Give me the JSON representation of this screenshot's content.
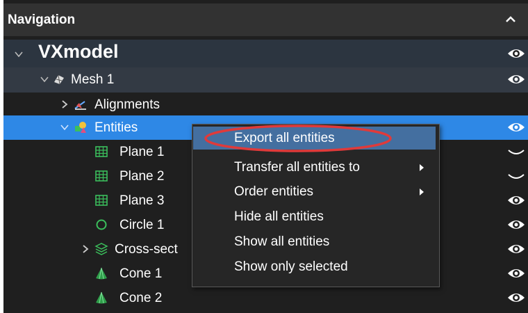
{
  "panel": {
    "title": "Navigation"
  },
  "tree": {
    "model": "VXmodel",
    "mesh": "Mesh 1",
    "alignments": "Alignments",
    "entities": "Entities",
    "items": [
      {
        "label": "Plane 1",
        "icon": "plane-icon"
      },
      {
        "label": "Plane 2",
        "icon": "plane-icon"
      },
      {
        "label": "Plane 3",
        "icon": "plane-icon"
      },
      {
        "label": "Circle 1",
        "icon": "circle-icon"
      },
      {
        "label": "Cross-sect",
        "icon": "cross-section-icon"
      },
      {
        "label": "Cone 1",
        "icon": "cone-icon"
      },
      {
        "label": "Cone 2",
        "icon": "cone-icon"
      }
    ]
  },
  "context_menu": {
    "items": [
      {
        "label": "Export all entities",
        "submenu": false
      },
      {
        "label": "Transfer all entities to",
        "submenu": true
      },
      {
        "label": "Order entities",
        "submenu": true
      },
      {
        "label": "Hide all entities",
        "submenu": false
      },
      {
        "label": "Show all entities",
        "submenu": false
      },
      {
        "label": "Show only selected",
        "submenu": false
      }
    ]
  },
  "colors": {
    "selection": "#2e88e6",
    "menu_highlight": "#446fa0",
    "annotation": "#e03a3a"
  }
}
